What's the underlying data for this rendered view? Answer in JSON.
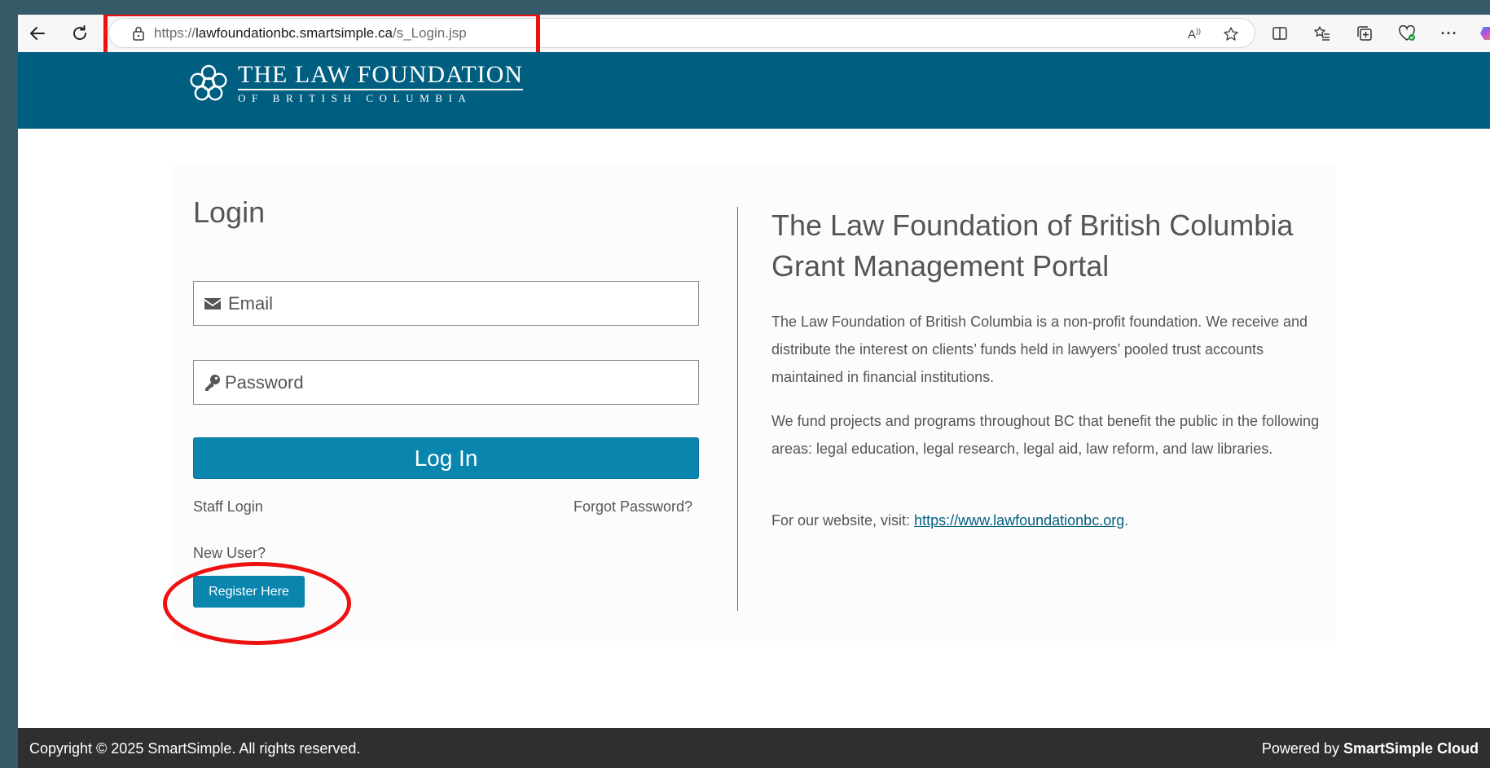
{
  "browser": {
    "url_protocol": "https://",
    "url_domain": "lawfoundationbc.smartsimple.ca",
    "url_path": "/s_Login.jsp",
    "icons": [
      "back-icon",
      "refresh-icon",
      "lock-icon",
      "read-aloud-icon",
      "favorite-star-icon",
      "split-screen-icon",
      "favorites-icon",
      "collections-icon",
      "browser-essentials-icon",
      "more-icon",
      "copilot-icon"
    ],
    "read_aloud_label": "A"
  },
  "header": {
    "logo_line1": "THE LAW FOUNDATION",
    "logo_line2": "OF BRITISH COLUMBIA",
    "bg_color": "#005f80"
  },
  "login": {
    "title": "Login",
    "email_placeholder": "Email",
    "password_placeholder": "Password",
    "login_button": "Log In",
    "staff_login": "Staff Login",
    "forgot_password": "Forgot Password?",
    "new_user": "New User?",
    "register_button": "Register Here",
    "accent_color": "#0a86ae"
  },
  "info": {
    "title_line1": "The Law Foundation of British Columbia",
    "title_line2": "Grant Management Portal",
    "para1": "The Law Foundation of British Columbia is a non-profit foundation. We receive and distribute the interest on clients’ funds held in lawyers’ pooled trust accounts maintained in financial institutions.",
    "para2": "We fund projects and programs throughout BC that benefit the public in the following areas: legal education, legal research, legal aid, law reform, and law libraries.",
    "para3_prefix": "For our website, visit: ",
    "website_link": "https://www.lawfoundationbc.org",
    "para3_suffix": "."
  },
  "footer": {
    "copyright": "Copyright © 2025 SmartSimple. All rights reserved.",
    "powered_prefix": "Powered by ",
    "powered_brand": "SmartSimple Cloud"
  },
  "annotations": {
    "highlight_color": "#ee1111"
  }
}
